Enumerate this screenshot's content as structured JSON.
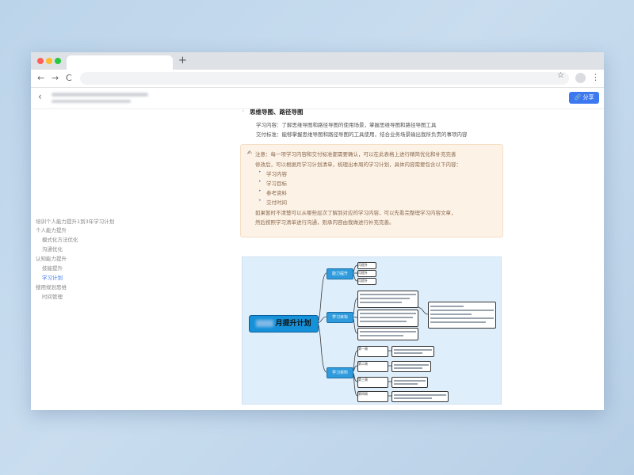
{
  "browser": {
    "tab_new_label": "+",
    "nav_back": "←",
    "nav_forward": "→",
    "nav_reload": "C",
    "star": "☆",
    "menu": "⋮",
    "window_dots": [
      "#ff5f57",
      "#febc2e",
      "#28c840"
    ]
  },
  "app": {
    "back_icon": "‹",
    "share_label": "分享",
    "share_color": "#3c78f0"
  },
  "outline": {
    "items": [
      "培训个人能力提升1到3年学习计划",
      "个人能力提升",
      "模式化方法优化",
      "沟通优化",
      "认知能力提升",
      "技能提升",
      "学习计划",
      "搜用规划思维",
      "时间管理"
    ]
  },
  "doc": {
    "heading": "思维导图、路径导图",
    "para1": "学习内容：了解思维导图和路径导图的使用场景，掌握思维导图和路径导图工具",
    "para2": "交付标准：能够掌握思维导图和路径导图的工具使用，结合业务场景输出我所负责的事项内容",
    "callout_lines": [
      "注意：每一项学习内容和交付标准都需要确认，可以在此表格上进行精简优化和补充完善",
      "修改后，可以根据月学习计划清单，梳理出本周的学习计划，具体内容需要包含以下内容："
    ],
    "callout_items": [
      "学习内容",
      "学习目标",
      "参考资料",
      "交付时间"
    ],
    "callout_tail": [
      "如果暂时不清楚可以从哪些层次了解到对应的学习内容，可以先看完整理学习内容文章，",
      "然后按照学习清单进行沟通，则承内容由我做进行补充完善。"
    ],
    "callout_icon": "✍"
  },
  "mindmap": {
    "root_label": "月提升计划",
    "branches": [
      "能力提升",
      "学习目标",
      "学习资料"
    ],
    "sub_top": [
      "月提升",
      "月提升",
      "月提升"
    ],
    "sub_bottom": [
      "第一周",
      "第二周",
      "第三周",
      "第四周"
    ]
  }
}
